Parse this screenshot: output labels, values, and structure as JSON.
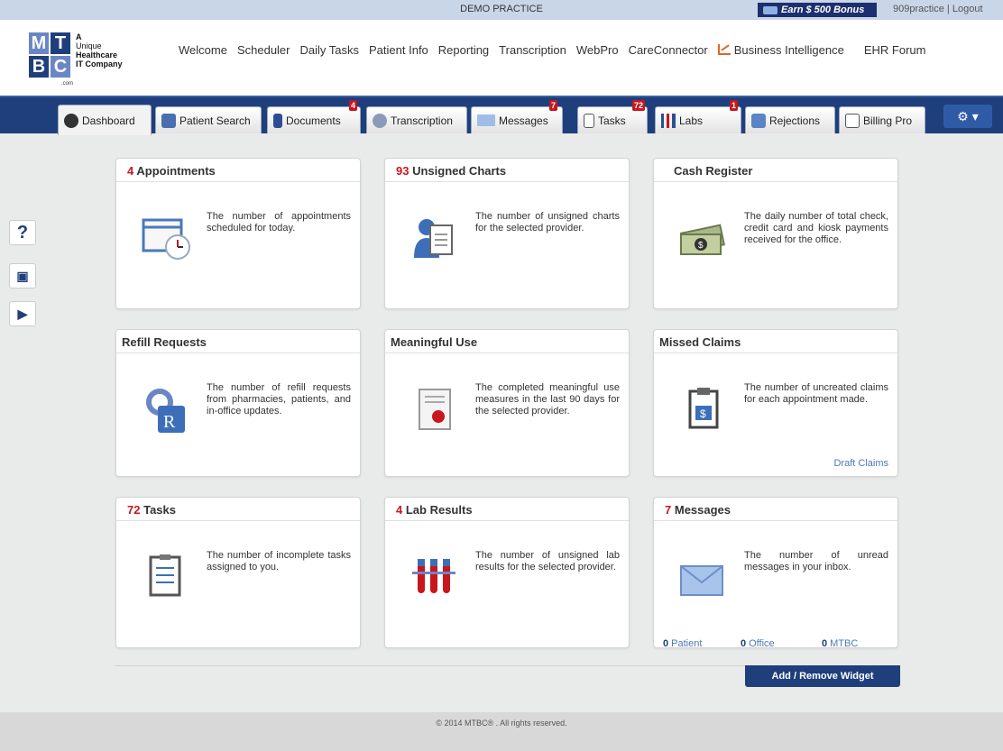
{
  "topbar": {
    "practice": "DEMO PRACTICE",
    "bonus": "Earn $ 500 Bonus",
    "user": "909practice",
    "logout": "Logout"
  },
  "logo": {
    "letters": [
      "M",
      "T",
      "B",
      "C"
    ],
    "tagline": [
      "A",
      "Unique",
      "Healthcare",
      "IT Company"
    ],
    "domain": ".com"
  },
  "nav": [
    "Welcome",
    "Scheduler",
    "Daily Tasks",
    "Patient Info",
    "Reporting",
    "Transcription",
    "WebPro",
    "CareConnector",
    "Business Intelligence",
    "EHR Forum"
  ],
  "tabs": [
    {
      "label": "Dashboard",
      "badge": ""
    },
    {
      "label": "Patient Search",
      "badge": ""
    },
    {
      "label": "Documents",
      "badge": "4"
    },
    {
      "label": "Transcription",
      "badge": ""
    },
    {
      "label": "Messages",
      "badge": "7"
    },
    {
      "label": "Tasks",
      "badge": "72"
    },
    {
      "label": "Labs",
      "badge": "1"
    },
    {
      "label": "Rejections",
      "badge": ""
    },
    {
      "label": "Billing Pro",
      "badge": ""
    }
  ],
  "sidetools": [
    "?"
  ],
  "widgets": [
    {
      "count": "4",
      "title": "Appointments",
      "desc": "The number of appointments scheduled for today.",
      "icon": "calendar-clock-icon"
    },
    {
      "count": "93",
      "title": "Unsigned Charts",
      "desc": "The number of unsigned charts for the selected provider.",
      "icon": "chart-user-icon"
    },
    {
      "count": "",
      "title": "Cash Register",
      "desc": "The daily number of total check, credit card and kiosk payments received for the office.",
      "icon": "cash-icon"
    },
    {
      "count": "",
      "title": "Refill Requests",
      "desc": "The number of refill requests from pharmacies, patients, and in-office updates.",
      "icon": "rx-icon"
    },
    {
      "count": "",
      "title": "Meaningful Use",
      "desc": "The completed meaningful use measures in the last 90 days for the selected provider.",
      "icon": "certificate-icon"
    },
    {
      "count": "",
      "title": "Missed Claims",
      "desc": "The number of uncreated claims for each appointment made.",
      "icon": "clipboard-dollar-icon",
      "link": "Draft Claims"
    },
    {
      "count": "72",
      "title": "Tasks",
      "desc": "The number of incomplete tasks assigned to you.",
      "icon": "checklist-icon"
    },
    {
      "count": "4",
      "title": "Lab Results",
      "desc": "The number of unsigned lab results for the selected provider.",
      "icon": "test-tubes-icon"
    },
    {
      "count": "7",
      "title": "Messages",
      "desc": "The number of unread messages in your inbox.",
      "icon": "envelope-icon"
    }
  ],
  "messages_counts": [
    {
      "num": "0",
      "label": "Patient"
    },
    {
      "num": "0",
      "label": "Office"
    },
    {
      "num": "0",
      "label": "MTBC"
    }
  ],
  "add_widget": "Add / Remove Widget",
  "footer": "© 2014 MTBC® . All rights reserved.",
  "colors": {
    "nav_bar": "#1f3f7c",
    "badge": "#c8161d",
    "count_text": "#c8161d",
    "link": "#4a78b8"
  }
}
